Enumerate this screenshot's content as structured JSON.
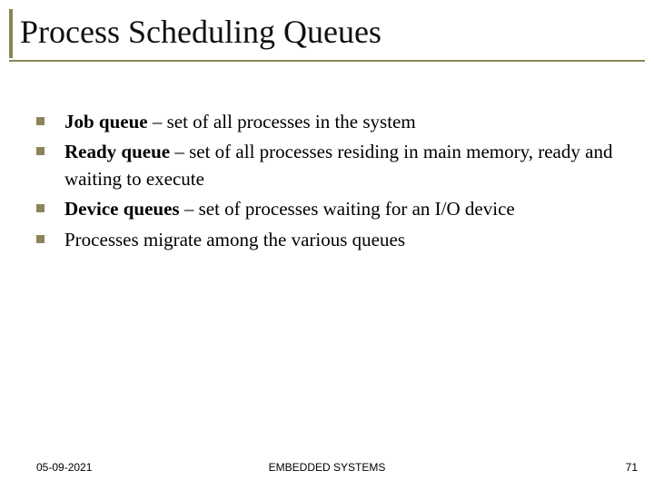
{
  "title": "Process Scheduling Queues",
  "bullets": [
    {
      "bold": "Job queue",
      "rest": " – set of all processes in the system"
    },
    {
      "bold": "Ready queue",
      "rest": " – set of all processes residing in main memory, ready and waiting to execute"
    },
    {
      "bold": "Device queues",
      "rest": " – set of processes waiting for an I/O device"
    },
    {
      "bold": "",
      "rest": "Processes migrate among the various queues"
    }
  ],
  "footer": {
    "date": "05-09-2021",
    "center": "EMBEDDED SYSTEMS",
    "page": "71"
  }
}
